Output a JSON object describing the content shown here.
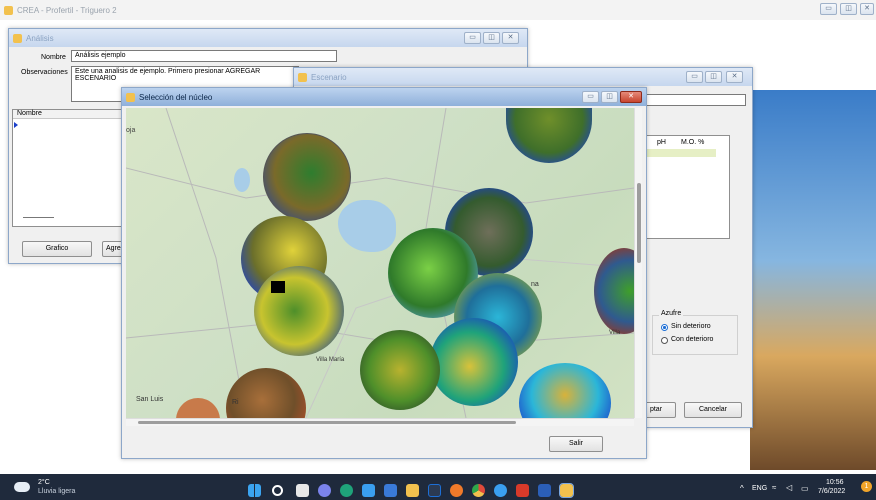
{
  "main_window": {
    "title": "CREA - Profertil - Triguero 2"
  },
  "analisis": {
    "title": "Análisis",
    "nombre_label": "Nombre",
    "nombre_value": "Análisis ejemplo",
    "observaciones_label": "Observaciones",
    "observaciones_value": "Este una analisis de ejemplo. Primero presionar AGREGAR ESCENARIO",
    "table_header": "Nombre",
    "grafico_btn": "Grafico",
    "agregar_btn": "Agre"
  },
  "escenario": {
    "title": "Escenario",
    "col_ph": "pH",
    "col_mo": "M.O. %",
    "azufre_label": "Azufre",
    "opt_sin": "Sin deterioro",
    "opt_con": "Con deterioro",
    "aceptar_btn": "ptar",
    "cancelar_btn": "Cancelar"
  },
  "seleccion": {
    "title": "Selección del núcleo",
    "salir_btn": "Salir",
    "places": [
      "oja",
      "Villa María",
      "San Luis",
      "Ri",
      "na",
      "Villa"
    ]
  },
  "taskbar": {
    "temp": "2°C",
    "weather": "Lluvia ligera",
    "lang": "ENG",
    "time": "10:56",
    "date": "7/6/2022",
    "notifications": "1"
  },
  "colors": {
    "accent": "#1d6fd6",
    "map_base": "#cfe0c6",
    "water": "#a8cde8",
    "taskbar": "#1f2a3c"
  }
}
